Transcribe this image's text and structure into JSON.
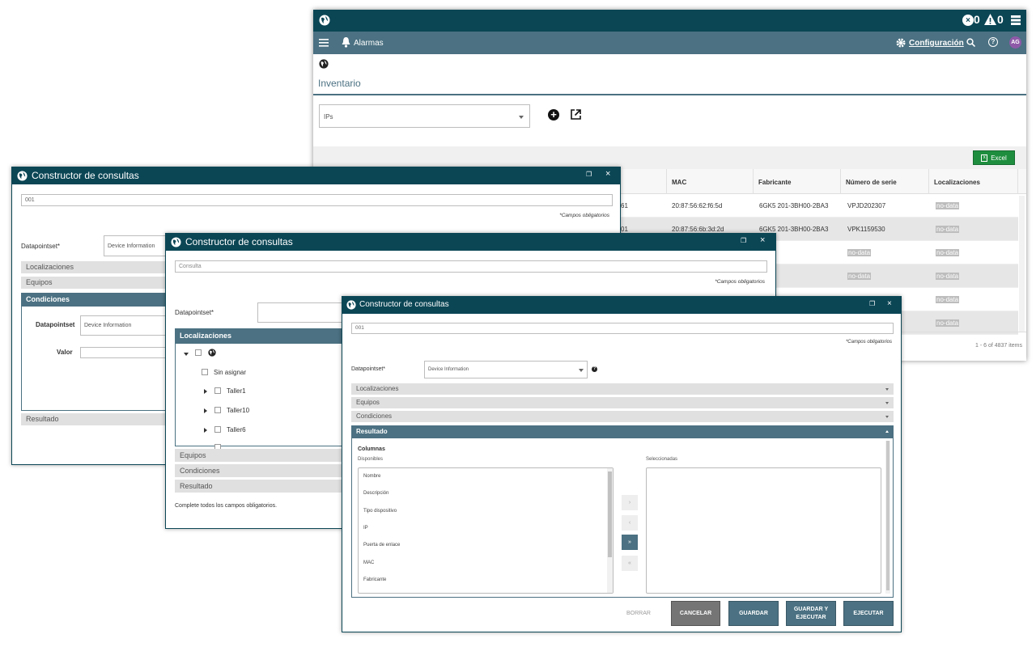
{
  "app": {
    "status": {
      "errors": "0",
      "warnings": "0"
    },
    "nav": {
      "alarms": "Alarmas",
      "config": "Configuración",
      "avatar": "AG"
    },
    "page_title": "Inventario",
    "selector": {
      "value": "IPs"
    },
    "excel_label": "Excel",
    "table": {
      "headers": [
        "MAC",
        "Fabricante",
        "Número de serie",
        "Localizaciones"
      ],
      "rows": [
        {
          "ip_tail": "61",
          "mac": "20:87:56:62:f6:5d",
          "fabricante": "6GK5 201-3BH00-2BA3",
          "serie": "VPJD202307",
          "loc": "no-data"
        },
        {
          "ip_tail": "01",
          "mac": "20:87:56:6b:3d:2d",
          "fabricante": "6GK5 201-3BH00-2BA3",
          "serie": "VPK1159530",
          "loc": "no-data"
        },
        {
          "serie": "no-data",
          "loc": "no-data"
        },
        {
          "serie": "no-data",
          "loc": "no-data"
        },
        {
          "loc": "no-data"
        },
        {
          "loc": "no-data"
        }
      ],
      "pager": "1 - 6 of 4837 items"
    }
  },
  "dlg1": {
    "title": "Constructor de consultas",
    "query_value": "001",
    "mandatory": "*Campos obligatorios",
    "datapointset_label": "Datapointset*",
    "datapointset_value": "Device Information",
    "sections": [
      "Localizaciones",
      "Equipos",
      "Condiciones",
      "Resultado"
    ],
    "cond_dps_label": "Datapointset",
    "cond_dps_value": "Device Information",
    "cond_valor_label": "Valor"
  },
  "dlg2": {
    "title": "Constructor de consultas",
    "query_placeholder": "Consulta",
    "mandatory": "*Campos obligatorios",
    "datapointset_label": "Datapointset*",
    "sections": [
      "Localizaciones",
      "Equipos",
      "Condiciones",
      "Resultado"
    ],
    "tree": [
      "Sin asignar",
      "Taller1",
      "Taller10",
      "Taller6"
    ],
    "footer_msg": "Complete todos los campos obligatorios."
  },
  "dlg3": {
    "title": "Constructor de consultas",
    "query_value": "001",
    "mandatory": "*Campos obligatorios",
    "datapointset_label": "Datapointset*",
    "datapointset_value": "Device Information",
    "sections": [
      "Localizaciones",
      "Equipos",
      "Condiciones",
      "Resultado"
    ],
    "columnas": "Columnas",
    "disponibles": "Disponibles",
    "seleccionadas": "Seleccionadas",
    "available": [
      "Nombre",
      "Descripción",
      "Tipo dispositivo",
      "IP",
      "Puerta de enlace",
      "MAC",
      "Fabricante"
    ],
    "buttons": {
      "borrar": "BORRAR",
      "cancelar": "CANCELAR",
      "guardar": "GUARDAR",
      "guardar_ejecutar": "GUARDAR Y EJECUTAR",
      "ejecutar": "EJECUTAR"
    }
  },
  "colors": {
    "dark": "#0b4655",
    "mid": "#4b7182",
    "excel": "#1e8e3e",
    "cancel": "#757575"
  }
}
